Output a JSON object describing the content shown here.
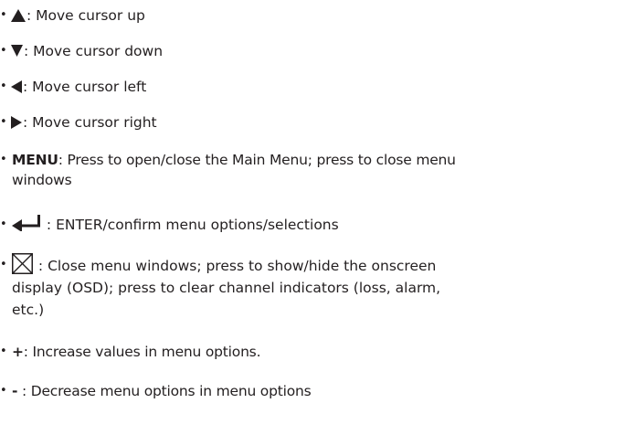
{
  "items": [
    {
      "icon": "triangle-up-icon",
      "key": "",
      "text": ": Move cursor up"
    },
    {
      "icon": "triangle-down-icon",
      "key": "",
      "text": ": Move cursor down"
    },
    {
      "icon": "triangle-left-icon",
      "key": "",
      "text": ": Move cursor left"
    },
    {
      "icon": "triangle-right-icon",
      "key": "",
      "text": ": Move cursor right"
    },
    {
      "icon": "",
      "key": "MENU",
      "text": ": Press to open/close the Main Menu; press to close menu",
      "text2": "windows"
    },
    {
      "icon": "enter-arrow-icon",
      "key": "",
      "text": " : ENTER/confirm menu options/selections"
    },
    {
      "icon": "close-box-icon",
      "key": "",
      "text": " : Close menu windows; press to show/hide the onscreen",
      "text2": "display (OSD); press to clear channel indicators (loss, alarm,",
      "text3": "etc.)"
    },
    {
      "icon": "",
      "key": "+",
      "text": ": Increase values in menu options."
    },
    {
      "icon": "",
      "key": "-",
      "text": " : Decrease menu options in menu options"
    }
  ],
  "bullet_char": "•"
}
